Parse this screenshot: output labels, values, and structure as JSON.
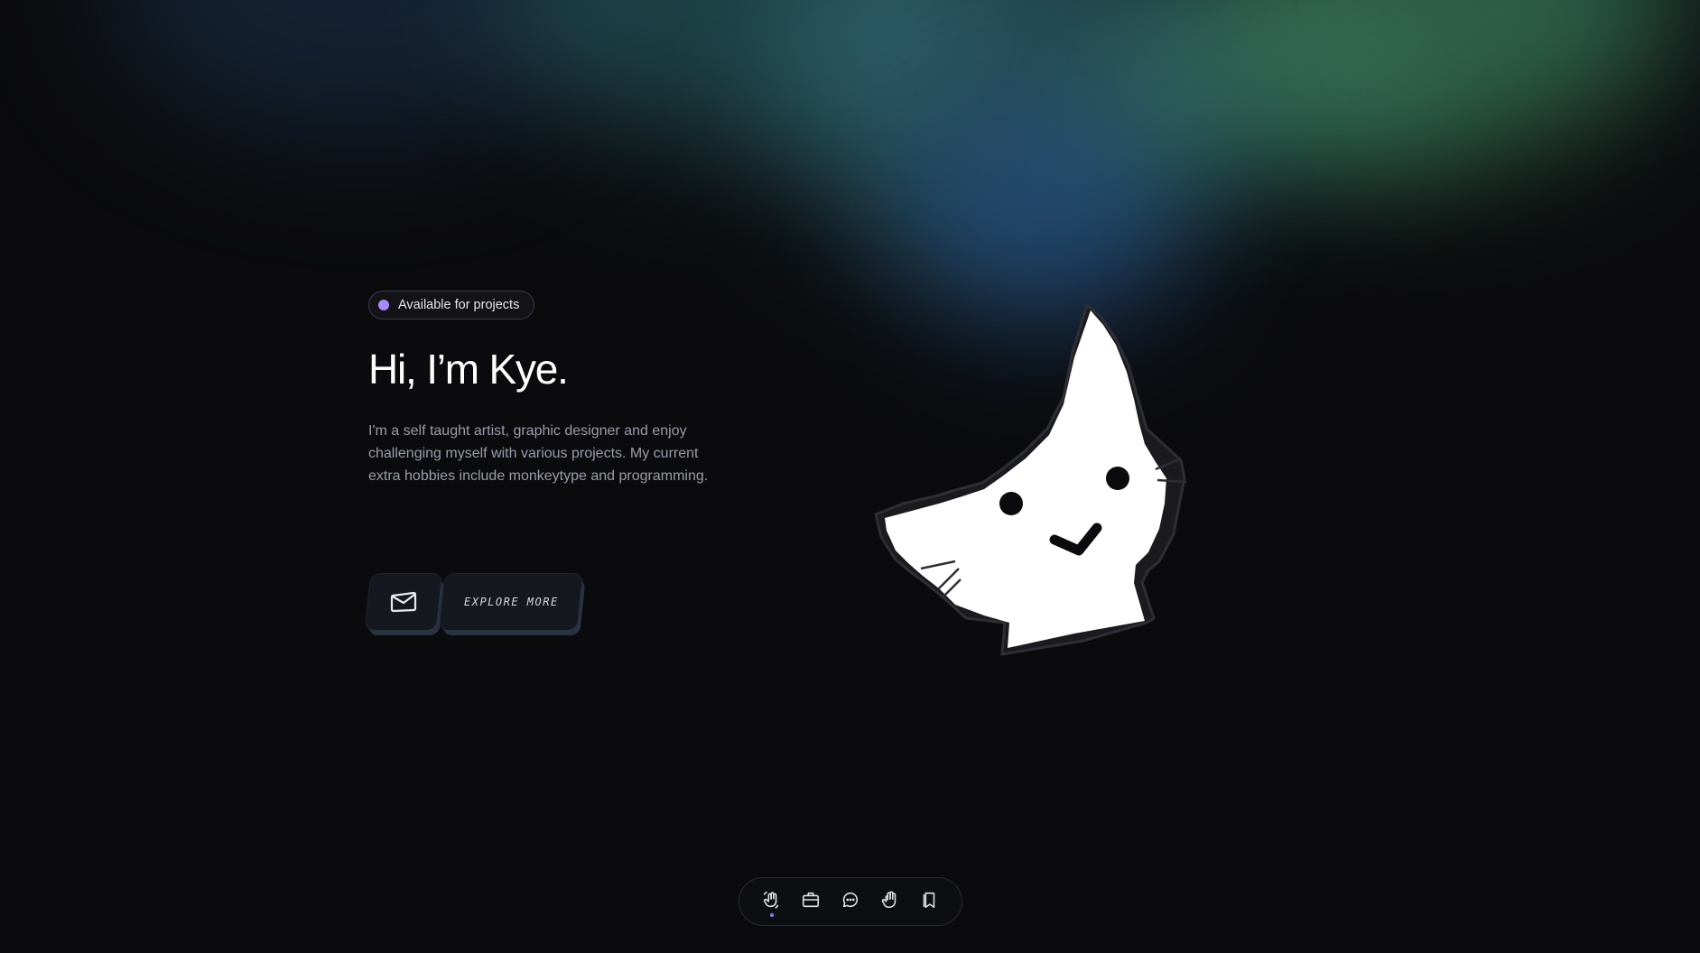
{
  "theme": {
    "background": "#0b0b0d",
    "accent": "#a78bfa",
    "text": "#ffffff",
    "muted_text": "#9a9cab"
  },
  "hero": {
    "badge": {
      "text": "Available for projects",
      "dot_color": "#a78bfa"
    },
    "title": "Hi, I’m Kye.",
    "bio": "I'm a self taught artist, graphic designer and enjoy challenging myself with various projects. My current extra hobbies include monkeytype and programming."
  },
  "actions": {
    "mail_icon": "envelope-icon",
    "explore_label": "EXPLORE MORE"
  },
  "illustration": {
    "icon": "cat-illustration"
  },
  "dock": {
    "items": [
      {
        "icon": "wave-hand-icon",
        "active": true
      },
      {
        "icon": "briefcase-icon",
        "active": false
      },
      {
        "icon": "chat-bubble-icon",
        "active": false
      },
      {
        "icon": "raised-hand-icon",
        "active": false
      },
      {
        "icon": "bookmarks-icon",
        "active": false
      }
    ]
  }
}
